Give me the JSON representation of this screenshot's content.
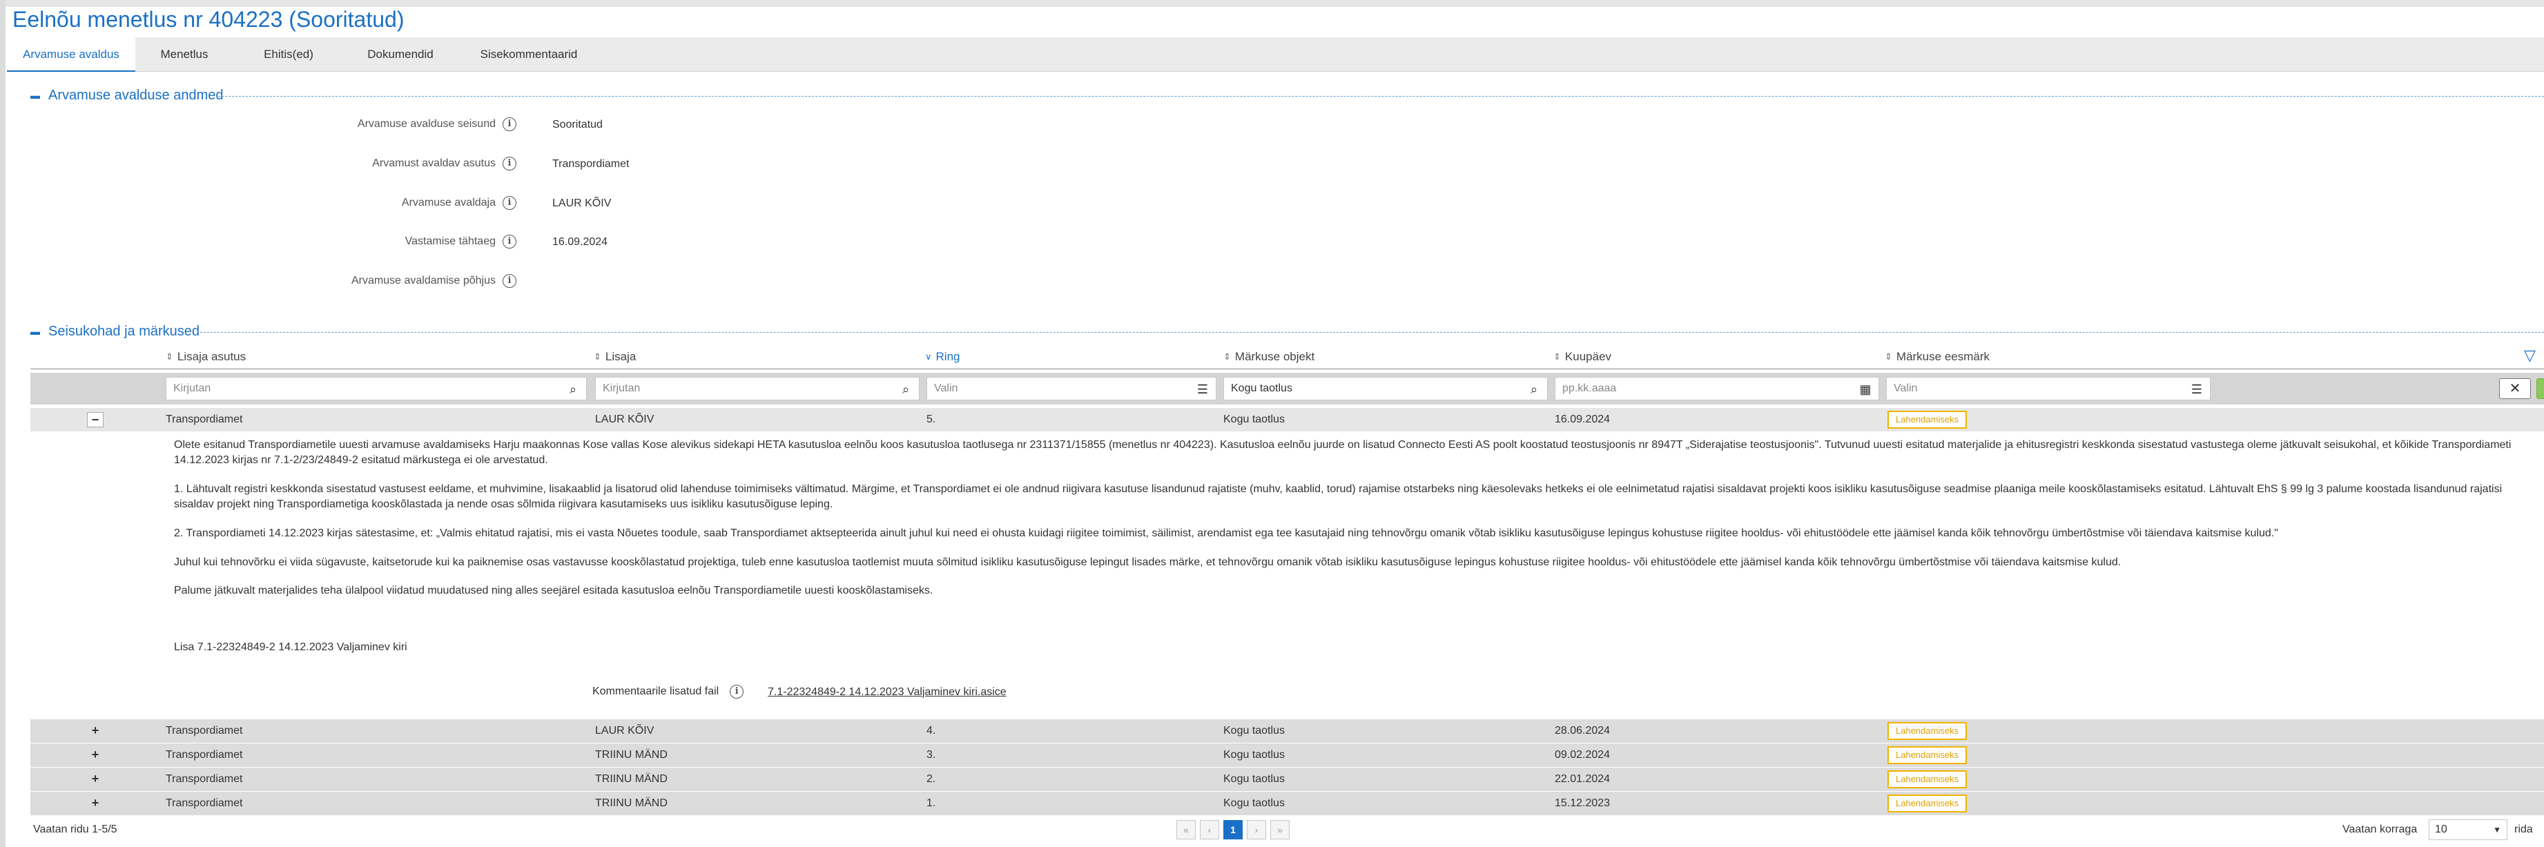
{
  "page_title": "Eelnõu menetlus nr 404223 (Sooritatud)",
  "tabs": [
    {
      "label": "Arvamuse avaldus",
      "active": true
    },
    {
      "label": "Menetlus"
    },
    {
      "label": "Ehitis(ed)"
    },
    {
      "label": "Dokumendid"
    },
    {
      "label": "Sisekommentaarid"
    }
  ],
  "section1": {
    "title": "Arvamuse avalduse andmed",
    "fields": [
      {
        "label": "Arvamuse avalduse seisund",
        "value": "Sooritatud"
      },
      {
        "label": "Arvamust avaldav asutus",
        "value": "Transpordiamet"
      },
      {
        "label": "Arvamuse avaldaja",
        "value": "LAUR KÕIV"
      },
      {
        "label": "Vastamise tähtaeg",
        "value": "16.09.2024"
      },
      {
        "label": "Arvamuse avaldamise põhjus",
        "value": ""
      }
    ]
  },
  "section2": {
    "title": "Seisukohad ja märkused",
    "columns": {
      "asutus": "Lisaja asutus",
      "lisaja": "Lisaja",
      "ring": "Ring",
      "objekt": "Märkuse objekt",
      "kuupaev": "Kuupäev",
      "eesmark": "Märkuse eesmärk"
    },
    "filters": {
      "asutus_placeholder": "Kirjutan",
      "lisaja_placeholder": "Kirjutan",
      "ring_placeholder": "Valin",
      "objekt_value": "Kogu taotlus",
      "kuupaev_placeholder": "pp.kk.aaaa",
      "eesmark_placeholder": "Valin"
    },
    "rows": [
      {
        "toggle": "−",
        "asutus": "Transpordiamet",
        "lisaja": "LAUR KÕIV",
        "ring": "5.",
        "objekt": "Kogu taotlus",
        "kuupaev": "16.09.2024",
        "eesmark": "Lahendamiseks"
      },
      {
        "toggle": "+",
        "asutus": "Transpordiamet",
        "lisaja": "LAUR KÕIV",
        "ring": "4.",
        "objekt": "Kogu taotlus",
        "kuupaev": "28.06.2024",
        "eesmark": "Lahendamiseks"
      },
      {
        "toggle": "+",
        "asutus": "Transpordiamet",
        "lisaja": "TRIINU MÄND",
        "ring": "3.",
        "objekt": "Kogu taotlus",
        "kuupaev": "09.02.2024",
        "eesmark": "Lahendamiseks"
      },
      {
        "toggle": "+",
        "asutus": "Transpordiamet",
        "lisaja": "TRIINU MÄND",
        "ring": "2.",
        "objekt": "Kogu taotlus",
        "kuupaev": "22.01.2024",
        "eesmark": "Lahendamiseks"
      },
      {
        "toggle": "+",
        "asutus": "Transpordiamet",
        "lisaja": "TRIINU MÄND",
        "ring": "1.",
        "objekt": "Kogu taotlus",
        "kuupaev": "15.12.2023",
        "eesmark": "Lahendamiseks"
      }
    ],
    "detail": {
      "p1": "Olete esitanud Transpordiametile uuesti arvamuse avaldamiseks Harju maakonnas Kose vallas Kose alevikus sidekapi HETA kasutusloa eelnõu koos kasutusloa taotlusega nr 2311371/15855 (menetlus nr 404223). Kasutusloa eelnõu juurde on lisatud Connecto Eesti AS poolt koostatud teostusjoonis nr 8947T „Siderajatise teostusjoonis\". Tutvunud uuesti esitatud materjalide ja ehitusregistri keskkonda sisestatud vastustega oleme jätkuvalt seisukohal, et kõikide Transpordiameti 14.12.2023 kirjas nr 7.1-2/23/24849-2 esitatud märkustega ei ole arvestatud.",
      "p2": "1. Lähtuvalt registri keskkonda sisestatud vastusest eeldame, et muhvimine, lisakaablid ja lisatorud olid lahenduse toimimiseks vältimatud. Märgime, et Transpordiamet ei ole andnud riigivara kasutuse lisandunud rajatiste (muhv, kaablid, torud) rajamise otstarbeks ning käesolevaks hetkeks ei ole eelnimetatud rajatisi sisaldavat projekti koos isikliku kasutusõiguse seadmise plaaniga meile kooskõlastamiseks esitatud.  Lähtuvalt EhS § 99 lg 3 palume koostada lisandunud rajatisi sisaldav projekt ning Transpordiametiga kooskõlastada ja nende osas sõlmida riigivara kasutamiseks uus isikliku kasutusõiguse leping.",
      "p3": "2. Transpordiameti 14.12.2023 kirjas sätestasime, et: „Valmis ehitatud rajatisi, mis ei vasta Nõuetes toodule, saab Transpordiamet aktsepteerida ainult juhul kui need ei ohusta kuidagi riigitee toimimist, säilimist, arendamist ega tee kasutajaid ning tehnovõrgu omanik võtab isikliku kasutusõiguse lepingus kohustuse riigitee hooldus- või ehitustöödele ette jäämisel kanda kõik tehnovõrgu ümbertõstmise või täiendava kaitsmise kulud.\"",
      "p4": "Juhul kui tehnovõrku ei viida sügavuste, kaitsetorude kui ka paiknemise osas vastavusse kooskõlastatud projektiga, tuleb enne kasutusloa taotlemist muuta sõlmitud isikliku kasutusõiguse lepingut lisades märke, et tehnovõrgu omanik võtab isikliku kasutusõiguse lepingus kohustuse riigitee hooldus- või ehitustöödele ette jäämisel kanda kõik tehnovõrgu ümbertõstmise või täiendava kaitsmise kulud.",
      "p5": "Palume jätkuvalt materjalides teha ülalpool viidatud muudatused ning alles seejärel esitada kasutusloa eelnõu Transpordiametile uuesti kooskõlastamiseks.",
      "p6": "Lisa 7.1-22324849-2 14.12.2023 Valjaminev kiri",
      "attachment_label": "Kommentaarile lisatud fail",
      "attachment_link": "7.1-22324849-2 14.12.2023 Valjaminev kiri.asice"
    }
  },
  "footer": {
    "rows_info": "Vaatan ridu 1-5/5",
    "current_page": "1",
    "page_size_label": "Vaatan korraga",
    "page_size": "10",
    "page_size_suffix": "rida"
  },
  "colors": {
    "accent": "#1a70c6",
    "badge": "#f0b400",
    "apply_button": "#8cc85a",
    "row_bg": "#dcdcdc"
  },
  "icons": {
    "info": "info-icon",
    "search": "search-icon",
    "list": "list-icon",
    "calendar": "calendar-icon",
    "filter": "funnel-icon",
    "sort": "sort-icon",
    "close": "close-icon",
    "check": "check-icon"
  }
}
